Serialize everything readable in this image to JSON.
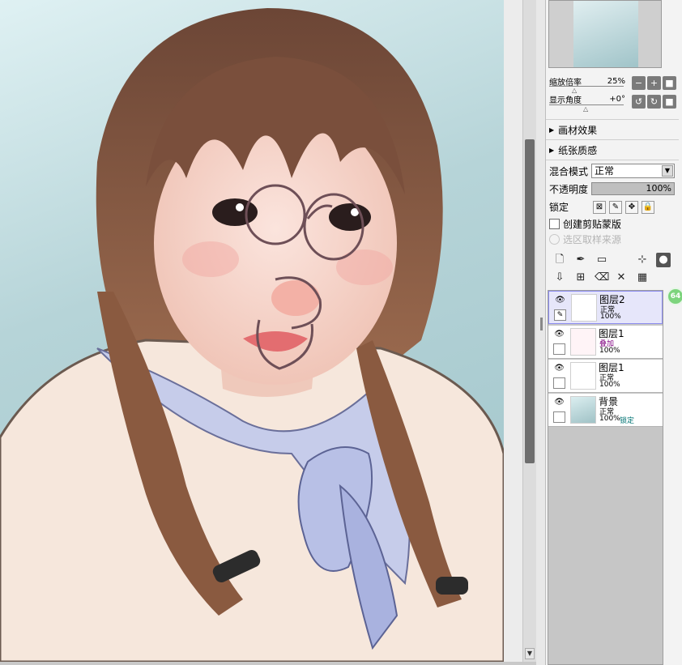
{
  "canvas": {
    "icon": "portrait-artwork"
  },
  "navigator": {
    "label": ""
  },
  "view": {
    "zoom_label": "缩放倍率",
    "zoom_value": "25%",
    "rotate_label": "显示角度",
    "rotate_value": "+0°",
    "zoom_buttons": [
      "−",
      "+",
      "■"
    ],
    "rotate_buttons": [
      "↺",
      "↻",
      "■"
    ]
  },
  "sections": {
    "canvas_effect": "画材效果",
    "paper_texture": "纸张质感"
  },
  "layer_props": {
    "blend_label": "混合模式",
    "blend_value": "正常",
    "opacity_label": "不透明度",
    "opacity_value": "100%",
    "lock_label": "锁定",
    "clip_label": "创建剪贴蒙版",
    "select_source_label": "选区取样来源"
  },
  "layers": [
    {
      "name": "图层2",
      "mode": "正常",
      "opacity": "100%",
      "lock": "",
      "selected": true,
      "mode_color": "#000000"
    },
    {
      "name": "图层1",
      "mode": "叠加",
      "opacity": "100%",
      "lock": "",
      "selected": false,
      "mode_color": "#800080"
    },
    {
      "name": "图层1",
      "mode": "正常",
      "opacity": "100%",
      "lock": "",
      "selected": false,
      "mode_color": "#000000"
    },
    {
      "name": "背景",
      "mode": "正常",
      "opacity": "100%",
      "lock": "锁定",
      "selected": false,
      "mode_color": "#000000"
    }
  ],
  "badge": "64",
  "colors": {
    "selected_layer": "#e6e6fa",
    "accent_border": "#8c8cf0",
    "badge": "#7dd47d"
  }
}
